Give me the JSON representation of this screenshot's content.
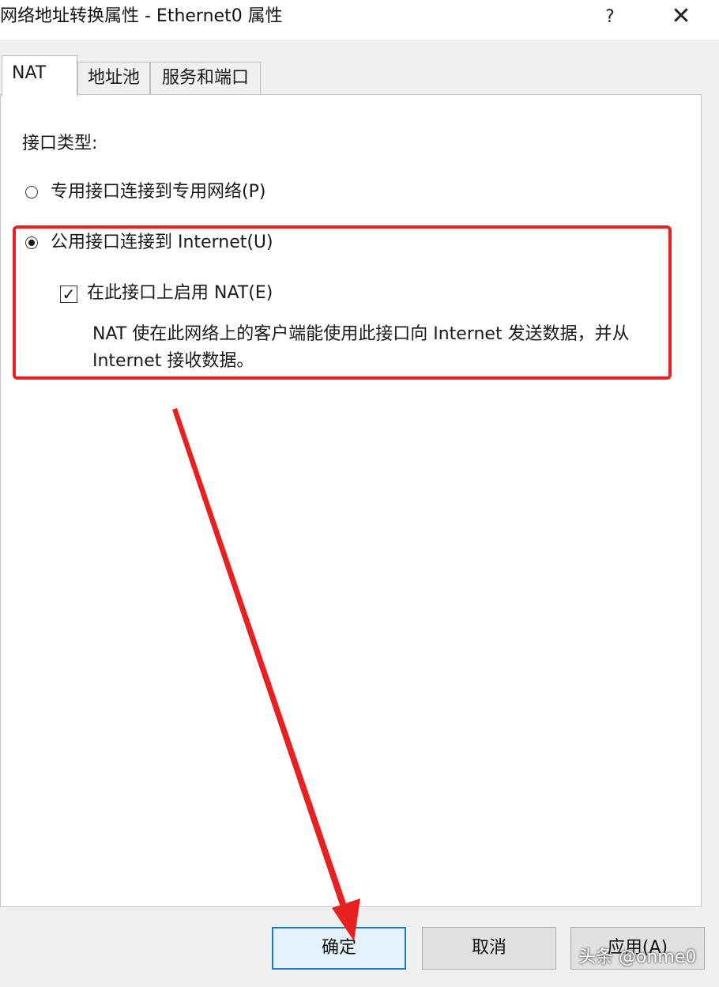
{
  "window": {
    "title": "网络地址转换属性 - Ethernet0 属性",
    "help_label": "?",
    "close_label": "✕"
  },
  "tabs": [
    {
      "label": "NAT",
      "active": true
    },
    {
      "label": "地址池",
      "active": false
    },
    {
      "label": "服务和端口",
      "active": false
    }
  ],
  "nat": {
    "interface_type_label": "接口类型:",
    "private_option": {
      "label": "专用接口连接到专用网络(P)",
      "checked": false
    },
    "public_option": {
      "label": "公用接口连接到 Internet(U)",
      "checked": true
    },
    "enable_nat": {
      "label": "在此接口上启用 NAT(E)",
      "checked": true
    },
    "description_line1": "NAT 使在此网络上的客户端能使用此接口向 Internet 发送数据，并从",
    "description_line2": "Internet 接收数据。"
  },
  "buttons": {
    "ok": "确定",
    "cancel": "取消",
    "apply": "应用(A)"
  },
  "annotation": {
    "color": "#e8201f"
  },
  "watermark": "头条 @onme0"
}
